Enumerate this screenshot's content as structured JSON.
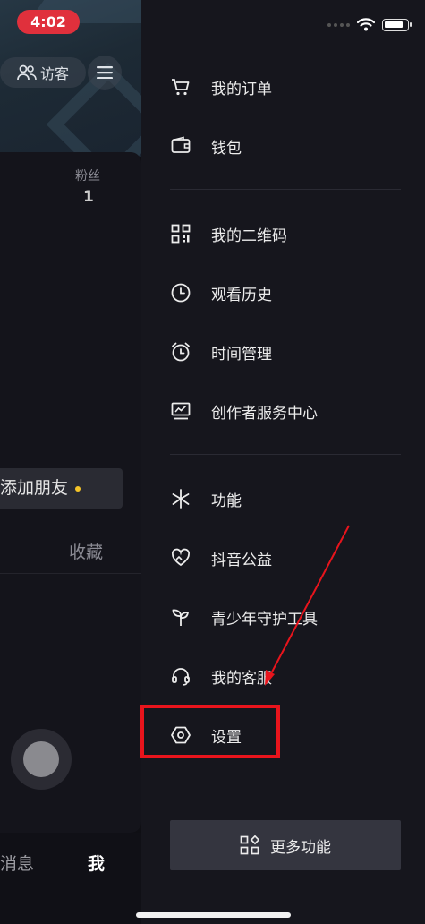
{
  "status_bar": {
    "time": "4:02"
  },
  "profile": {
    "visitor_label": "访客",
    "fans_label": "粉丝",
    "fans_count": "1",
    "add_friend_label": "添加朋友",
    "favorites_tab": "收藏",
    "bottom_tabs": {
      "messages": "消息",
      "me": "我"
    }
  },
  "drawer": {
    "items": [
      {
        "label": "我的订单",
        "icon": "cart-icon"
      },
      {
        "label": "钱包",
        "icon": "wallet-icon"
      },
      {
        "label": "我的二维码",
        "icon": "qrcode-icon"
      },
      {
        "label": "观看历史",
        "icon": "clock-icon"
      },
      {
        "label": "时间管理",
        "icon": "alarm-clock-icon"
      },
      {
        "label": "创作者服务中心",
        "icon": "monitor-chart-icon"
      },
      {
        "label": "功能",
        "icon": "asterisk-icon"
      },
      {
        "label": "抖音公益",
        "icon": "heart-hands-icon"
      },
      {
        "label": "青少年守护工具",
        "icon": "sprout-icon"
      },
      {
        "label": "我的客服",
        "icon": "headset-icon"
      },
      {
        "label": "设置",
        "icon": "gear-hexagon-icon"
      }
    ],
    "more_button": {
      "label": "更多功能",
      "icon": "grid-diamond-icon"
    }
  },
  "annotation": {
    "highlight_color": "#e8141c",
    "arrow_color": "#e8141c"
  }
}
